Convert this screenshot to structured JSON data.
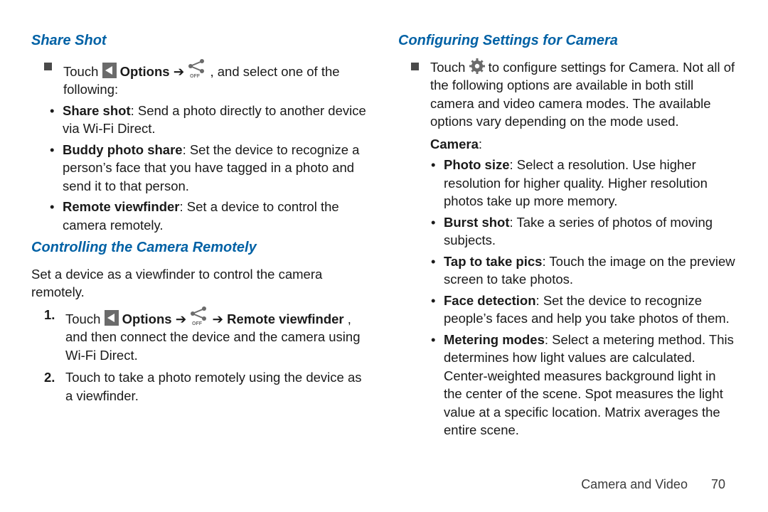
{
  "left": {
    "head1": "Share Shot",
    "touch": "Touch ",
    "options": "Options",
    "arrow": " ➔ ",
    "tail1": ", and select one of the following:",
    "bul": [
      {
        "t": "Share shot",
        "d": ": Send a photo directly to another device via Wi‑Fi Direct."
      },
      {
        "t": "Buddy photo share",
        "d": ": Set the device to recognize a person’s face that you have tagged in a photo and send it to that person."
      },
      {
        "t": "Remote viewfinder",
        "d": ": Set a device to control the camera remotely."
      }
    ],
    "head2": "Controlling the Camera Remotely",
    "intro": "Set a device as a viewfinder to control the camera remotely.",
    "step1a": "Touch ",
    "step1b": "Options",
    "step1c": " ➔ ",
    "step1d": " ➔ ",
    "step1e": "Remote viewfinder",
    "step1f": ", and then connect the device and the camera using Wi‑Fi Direct.",
    "step2": "Touch to take a photo remotely using the device as a viewfinder."
  },
  "right": {
    "head": "Configuring Settings for Camera",
    "touch": "Touch ",
    "tail": " to configure settings for Camera. Not all of the following options are available in both still camera and video camera modes. The available options vary depending on the mode used.",
    "camera_label": "Camera",
    "colon": ":",
    "bul": [
      {
        "t": "Photo size",
        "d": ": Select a resolution. Use higher resolution for higher quality. Higher resolution photos take up more memory."
      },
      {
        "t": "Burst shot",
        "d": ": Take a series of photos of moving subjects."
      },
      {
        "t": "Tap to take pics",
        "d": ": Touch the image on the preview screen to take photos."
      },
      {
        "t": "Face detection",
        "d": ": Set the device to recognize people’s faces and help you take photos of them."
      },
      {
        "t": "Metering modes",
        "d": ": Select a metering method. This determines how light values are calculated. Center-weighted measures background light in the center of the scene. Spot measures the light value at a specific location. Matrix averages the entire scene."
      }
    ]
  },
  "footer": {
    "section": "Camera and Video",
    "page": "70"
  }
}
